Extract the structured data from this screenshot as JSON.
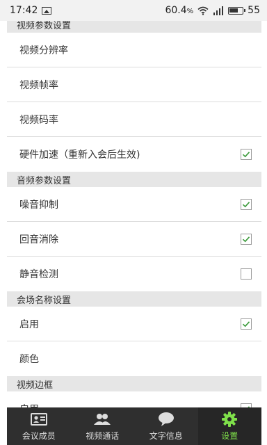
{
  "status_bar": {
    "time": "17:42",
    "signal_percent": "60.4",
    "percent_symbol": "%",
    "battery_level": "55",
    "icons": [
      "image-icon",
      "wifi-icon",
      "cell-signal-icon",
      "battery-icon"
    ]
  },
  "sections": [
    {
      "title": "视频参数设置",
      "items": [
        {
          "label": "视频分辨率"
        },
        {
          "label": "视频帧率"
        },
        {
          "label": "视频码率"
        },
        {
          "label": "硬件加速（重新入会后生效)",
          "checked": true
        }
      ]
    },
    {
      "title": "音频参数设置",
      "items": [
        {
          "label": "噪音抑制",
          "checked": true
        },
        {
          "label": "回音消除",
          "checked": true
        },
        {
          "label": "静音检测",
          "checked": false
        }
      ]
    },
    {
      "title": "会场名称设置",
      "items": [
        {
          "label": "启用",
          "checked": true
        },
        {
          "label": "颜色"
        }
      ]
    },
    {
      "title": "视频边框",
      "items": [
        {
          "label": "启用",
          "checked": true
        }
      ]
    }
  ],
  "tabs": [
    {
      "label": "会议成员",
      "icon": "member-card-icon",
      "active": false
    },
    {
      "label": "视频通话",
      "icon": "people-icon",
      "active": false
    },
    {
      "label": "文字信息",
      "icon": "chat-bubble-icon",
      "active": false
    },
    {
      "label": "设置",
      "icon": "gear-icon",
      "active": true
    }
  ],
  "colors": {
    "accent": "#7fe04a",
    "check": "#3a9a3a",
    "tab_bg": "#2f2f2f",
    "section_bg": "#e6e6e6"
  }
}
